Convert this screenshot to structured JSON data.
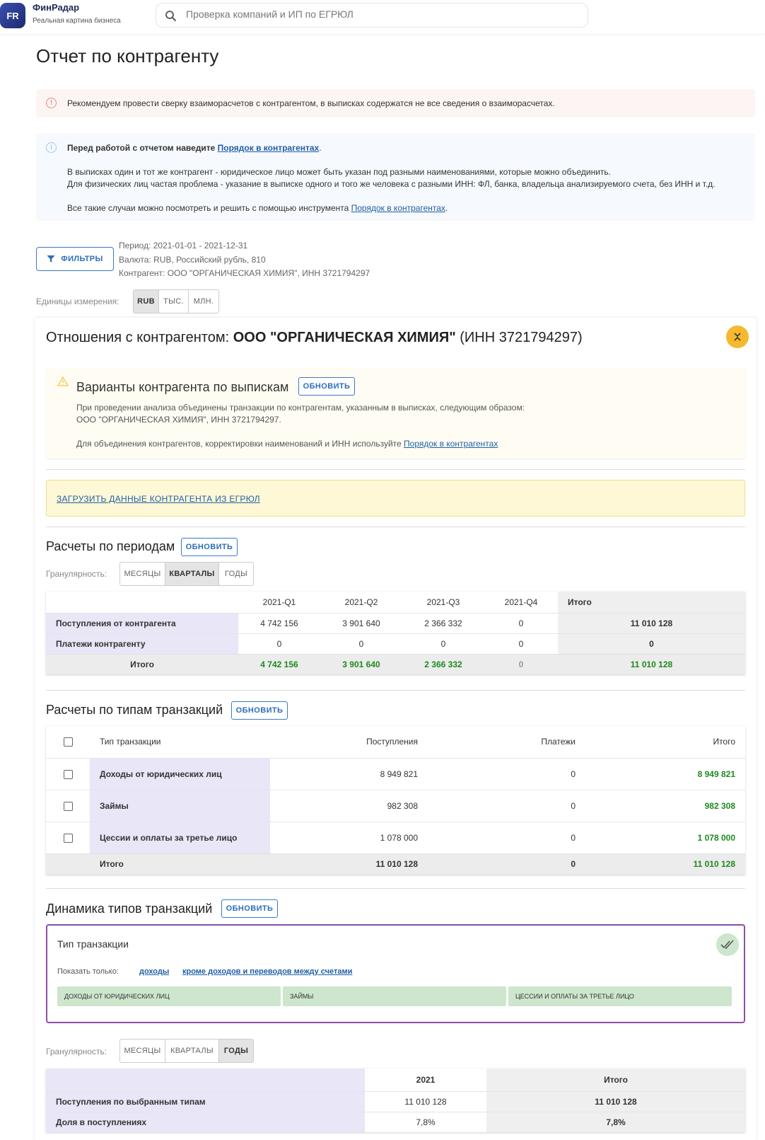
{
  "header": {
    "logo_text": "FR",
    "brand": "ФинРадар",
    "tagline": "Реальная картина бизнеса",
    "search_placeholder": "Проверка компаний и ИП по ЕГРЮЛ"
  },
  "page_title": "Отчет по контрагенту",
  "alert_recon": "Рекомендуем провести сверку взаиморасчетов с контрагентом, в выписках содержатся не все сведения о взаиморасчетах.",
  "info": {
    "lead_bold": "Перед работой с отчетом наведите ",
    "lead_link": "Порядок в контрагентах",
    "lead_end": ".",
    "p1": "В выписках один и тот же контрагент - юридическое лицо может быть указан под разными наименованиями, которые можно объединить.",
    "p2": "Для физических лиц частая проблема - указание в выписке одного и того же человека с разными ИНН: ФЛ, банка, владельца анализируемого счета, без ИНН и т.д.",
    "p3_text": "Все такие случаи можно посмотреть и решить с помощью инструмента ",
    "p3_link": "Порядок в контрагентах",
    "p3_end": "."
  },
  "filters": {
    "button": "ФИЛЬТРЫ",
    "period": "Период: 2021-01-01 - 2021-12-31",
    "currency": "Валюта: RUB, Российский рубль, 810",
    "counterparty": "Контрагент: ООО \"ОРГАНИЧЕСКАЯ ХИМИЯ\", ИНН 3721794297"
  },
  "units": {
    "label": "Единицы измерения:",
    "options": [
      "RUB",
      "ТЫС.",
      "МЛН."
    ],
    "selected": "RUB"
  },
  "relations": {
    "prefix": "Отношения с контрагентом: ",
    "name": "ООО \"ОРГАНИЧЕСКАЯ ХИМИЯ\"",
    "inn": " (ИНН 3721794297)"
  },
  "variants": {
    "title": "Варианты контрагента по выпискам",
    "refresh": "ОБНОВИТЬ",
    "line1": "При проведении анализа объединены транзакции по контрагентам, указанным в выписках, следующим образом:",
    "line2": "ООО \"ОРГАНИЧЕСКАЯ ХИМИЯ\", ИНН 3721794297.",
    "line3_text": "Для объединения контрагентов, корректировки наименований и ИНН используйте ",
    "line3_link": "Порядок в контрагентах"
  },
  "egrul_link": "ЗАГРУЗИТЬ ДАННЫЕ КОНТРАГЕНТА ИЗ ЕГРЮЛ",
  "periods": {
    "title": "Расчеты по периодам",
    "refresh": "ОБНОВИТЬ",
    "granularity_label": "Гранулярность:",
    "granularity": [
      "МЕСЯЦЫ",
      "КВАРТАЛЫ",
      "ГОДЫ"
    ],
    "granularity_selected": "КВАРТАЛЫ",
    "columns": [
      "2021-Q1",
      "2021-Q2",
      "2021-Q3",
      "2021-Q4",
      "Итого"
    ],
    "rows": [
      {
        "label": "Поступления от контрагента",
        "values": [
          "4 742 156",
          "3 901 640",
          "2 366 332",
          "0"
        ],
        "total": "11 010 128"
      },
      {
        "label": "Платежи контрагенту",
        "values": [
          "0",
          "0",
          "0",
          "0"
        ],
        "total": "0"
      }
    ],
    "total_row": {
      "label": "Итого",
      "values": [
        "4 742 156",
        "3 901 640",
        "2 366 332",
        "0"
      ],
      "total": "11 010 128"
    }
  },
  "types": {
    "title": "Расчеты по типам транзакций",
    "refresh": "ОБНОВИТЬ",
    "columns": [
      "Тип транзакции",
      "Поступления",
      "Платежи",
      "Итого"
    ],
    "rows": [
      {
        "label": "Доходы от юридических лиц",
        "income": "8 949 821",
        "payments": "0",
        "total": "8 949 821"
      },
      {
        "label": "Займы",
        "income": "982 308",
        "payments": "0",
        "total": "982 308"
      },
      {
        "label": "Цессии и оплаты за третье лицо",
        "income": "1 078 000",
        "payments": "0",
        "total": "1 078 000"
      }
    ],
    "total_row": {
      "label": "Итого",
      "income": "11 010 128",
      "payments": "0",
      "total": "11 010 128"
    }
  },
  "dynamics": {
    "title": "Динамика типов транзакций",
    "refresh": "ОБНОВИТЬ",
    "picker_title": "Тип транзакции",
    "show_only_label": "Показать только:",
    "show_only_links": [
      "доходы",
      "кроме доходов и переводов между счетами"
    ],
    "chips": [
      "ДОХОДЫ ОТ ЮРИДИЧЕСКИХ ЛИЦ",
      "ЗАЙМЫ",
      "ЦЕССИИ И ОПЛАТЫ ЗА ТРЕТЬЕ ЛИЦО"
    ],
    "granularity_label": "Гранулярность:",
    "granularity": [
      "МЕСЯЦЫ",
      "КВАРТАЛЫ",
      "ГОДЫ"
    ],
    "granularity_selected": "ГОДЫ",
    "columns": [
      "2021",
      "Итого"
    ],
    "rows": [
      {
        "label": "Поступления по выбранным типам",
        "values": [
          "11 010 128"
        ],
        "total": "11 010 128"
      },
      {
        "label": "Доля в поступлениях",
        "values": [
          "7,8%"
        ],
        "total": "7,8%"
      }
    ]
  },
  "colors": {
    "accent": "#2d6fb8",
    "positive": "#1e8a1e",
    "collapse_button": "#f5b82e"
  }
}
